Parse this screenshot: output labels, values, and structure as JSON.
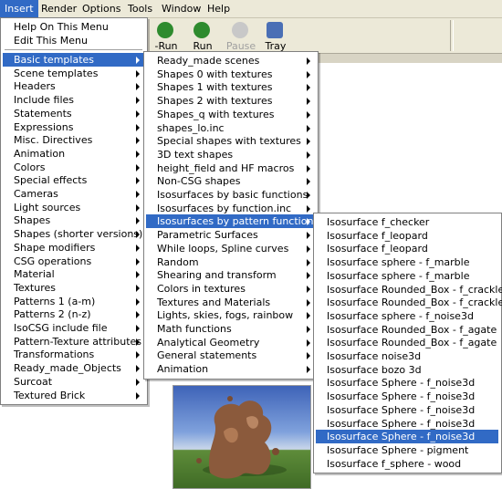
{
  "menubar": [
    "Insert",
    "Render",
    "Options",
    "Tools",
    "Window",
    "Help"
  ],
  "toolbar": {
    "buttons": [
      {
        "label": "-Run",
        "icon": "run-icon",
        "color": "#2e8b2e",
        "disabled": false
      },
      {
        "label": "Run",
        "icon": "run-icon",
        "color": "#2e8b2e",
        "disabled": false
      },
      {
        "label": "Pause",
        "icon": "pause-icon",
        "color": "#c0c0c0",
        "disabled": true
      },
      {
        "label": "Tray",
        "icon": "tray-icon",
        "color": "#4a6fb5",
        "disabled": false
      }
    ]
  },
  "insert_menu": {
    "top_items": [
      "Help On This Menu",
      "Edit This Menu"
    ],
    "items": [
      "Basic templates",
      "Scene templates",
      "Headers",
      "Include files",
      "Statements",
      "Expressions",
      "Misc. Directives",
      "Animation",
      "Colors",
      "Special effects",
      "Cameras",
      "Light sources",
      "Shapes",
      "Shapes (shorter versions)",
      "Shape modifiers",
      "CSG operations",
      "Material",
      "Textures",
      "Patterns 1 (a-m)",
      "Patterns 2 (n-z)",
      "IsoCSG include file",
      "Pattern-Texture attributes",
      "Transformations",
      "Ready_made_Objects",
      "Surcoat",
      "Textured Brick"
    ],
    "highlighted": 0
  },
  "basic_templates_menu": {
    "items": [
      "Ready_made scenes",
      "Shapes 0 with textures",
      "Shapes 1 with textures",
      "Shapes 2 with textures",
      "Shapes_q with textures",
      "shapes_lo.inc",
      "Special shapes with textures",
      "3D text shapes",
      "height_field and HF macros",
      "Non-CSG shapes",
      "Isosurfaces by basic functions",
      "Isosurfaces by function.inc",
      "Isosurfaces by pattern functions",
      "Parametric Surfaces",
      "While loops, Spline curves",
      "Random",
      "Shearing and transform",
      "Colors in textures",
      "Textures and Materials",
      "Lights, skies, fogs, rainbow",
      "Math functions",
      "Analytical Geometry",
      "General statements",
      "Animation"
    ],
    "highlighted": 12
  },
  "pattern_functions_menu": {
    "items": [
      "Isosurface f_checker",
      "Isosurface f_leopard",
      "Isosurface f_leopard",
      "Isosurface sphere - f_marble",
      "Isosurface sphere - f_marble",
      "Isosurface Rounded_Box - f_crackle",
      "Isosurface Rounded_Box - f_crackle",
      "Isosurface sphere - f_noise3d",
      "Isosurface Rounded_Box - f_agate",
      "Isosurface Rounded_Box - f_agate",
      "Isosurface noise3d",
      "Isosurface bozo 3d",
      "Isosurface Sphere - f_noise3d",
      "Isosurface Sphere - f_noise3d",
      "Isosurface Sphere - f_noise3d",
      "Isosurface Sphere - f_noise3d",
      "Isosurface Sphere - f_noise3d",
      "Isosurface Sphere - pigment",
      "Isosurface f_sphere - wood"
    ],
    "highlighted": 16
  },
  "colors": {
    "highlight": "#316ac5",
    "menubar_bg": "#ece9d8",
    "sky": "#3e63b8",
    "grass": "#4f7f2f",
    "object": "#8b5a3c"
  }
}
